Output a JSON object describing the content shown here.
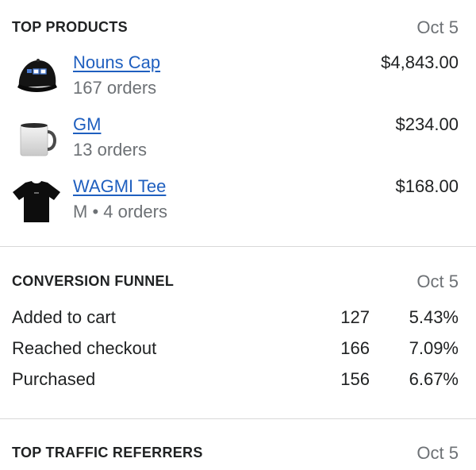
{
  "top_products": {
    "title": "TOP PRODUCTS",
    "date": "Oct 5",
    "items": [
      {
        "name": "Nouns Cap",
        "meta": "167 orders",
        "price": "$4,843.00",
        "icon": "cap-icon"
      },
      {
        "name": "GM",
        "meta": "13 orders",
        "price": "$234.00",
        "icon": "mug-icon"
      },
      {
        "name": "WAGMI Tee",
        "meta": "M • 4 orders",
        "price": "$168.00",
        "icon": "tshirt-icon"
      }
    ]
  },
  "conversion_funnel": {
    "title": "CONVERSION FUNNEL",
    "date": "Oct 5",
    "rows": [
      {
        "label": "Added to cart",
        "count": "127",
        "percent": "5.43%"
      },
      {
        "label": "Reached checkout",
        "count": "166",
        "percent": "7.09%"
      },
      {
        "label": "Purchased",
        "count": "156",
        "percent": "6.67%"
      }
    ]
  },
  "top_traffic_referrers": {
    "title": "TOP TRAFFIC REFERRERS",
    "date": "Oct 5"
  }
}
